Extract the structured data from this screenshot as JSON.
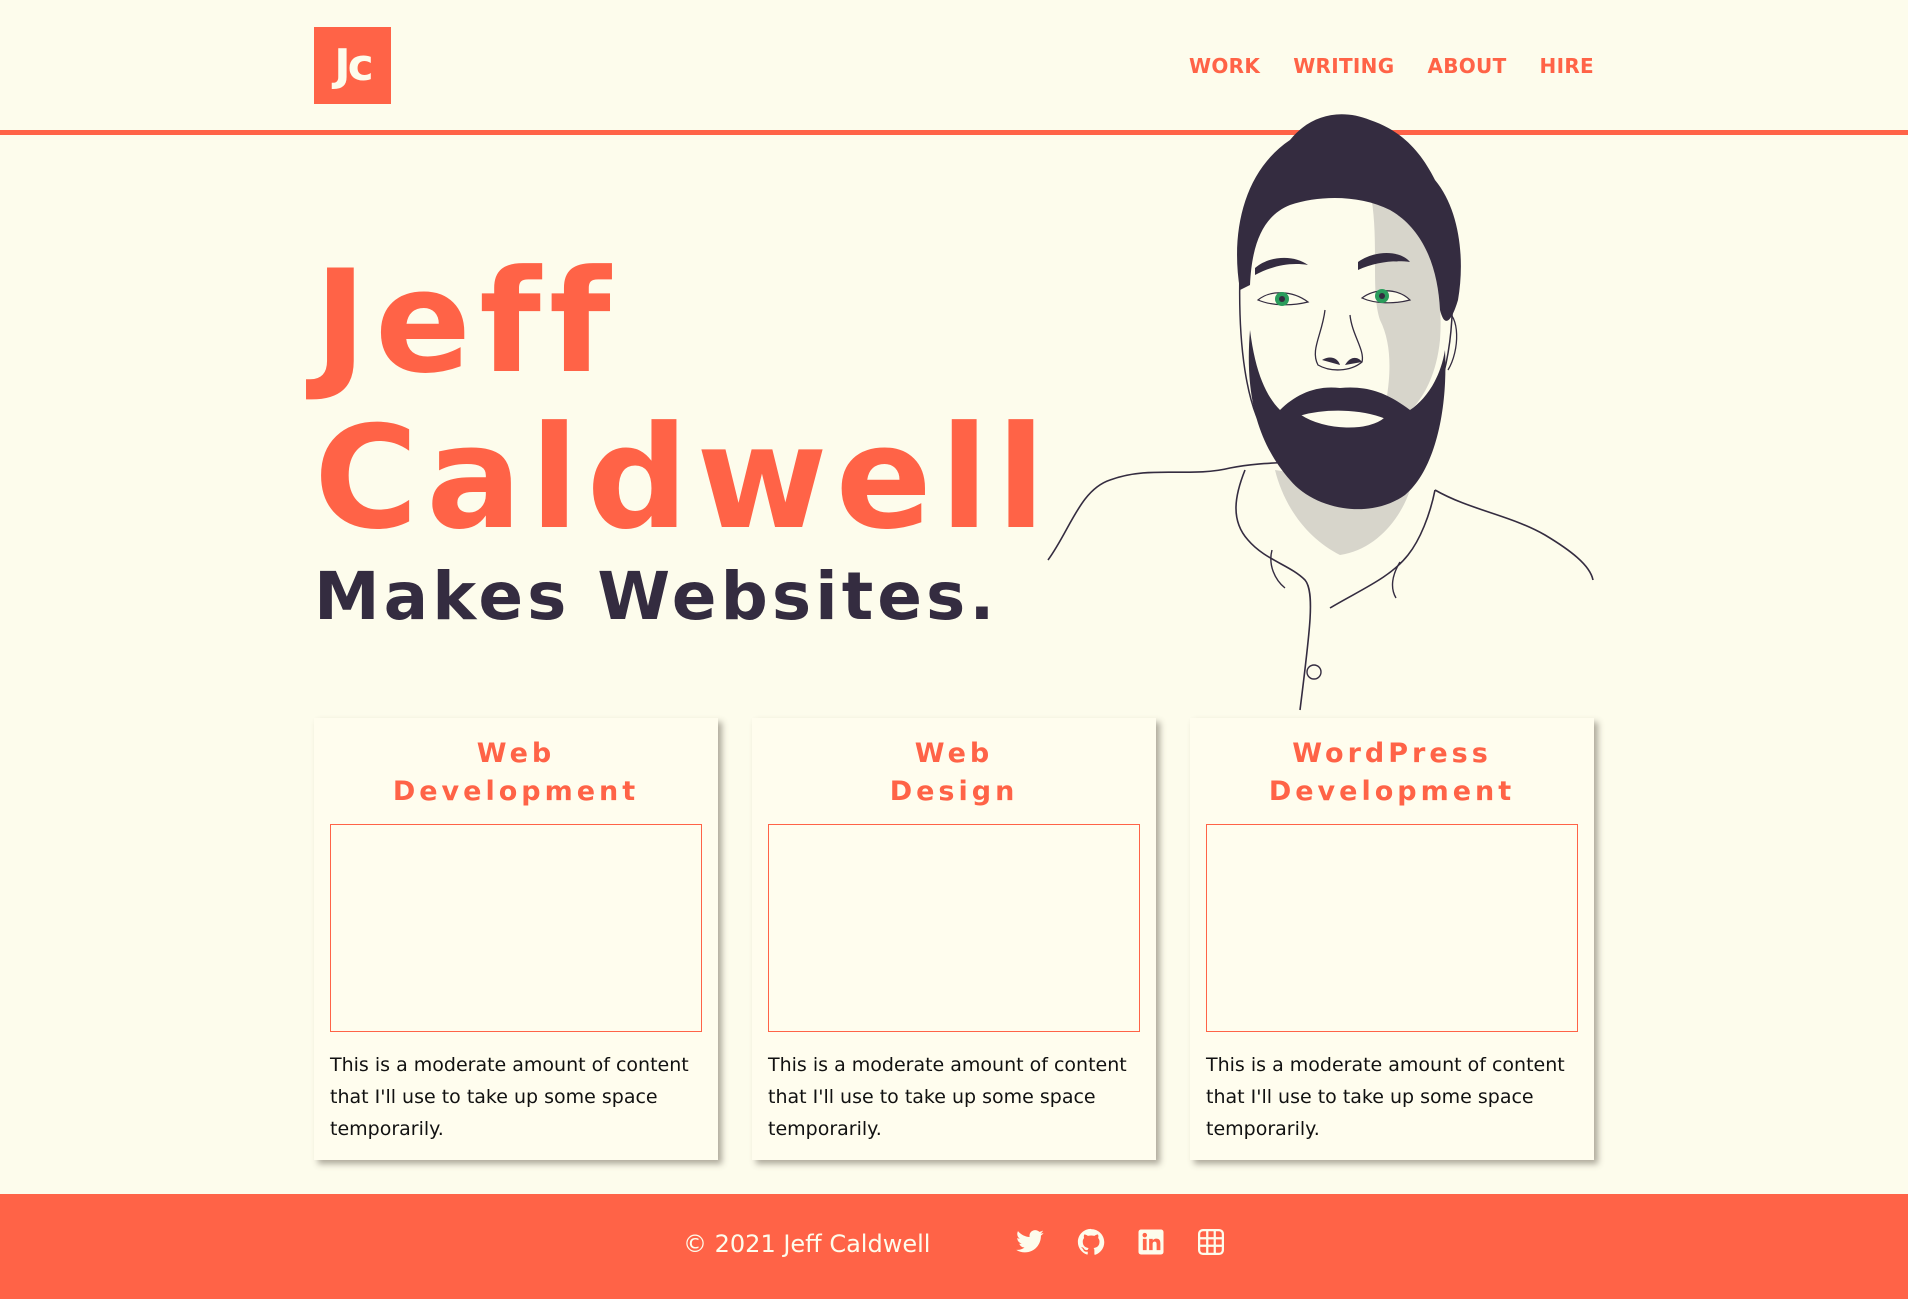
{
  "header": {
    "logo_text": "Jc",
    "nav": [
      "WORK",
      "WRITING",
      "ABOUT",
      "HIRE"
    ]
  },
  "hero": {
    "name_line1": "Jeff",
    "name_line2": "Caldwell",
    "tagline": "Makes Websites."
  },
  "cards": [
    {
      "title_line1": "Web",
      "title_line2": "Development",
      "text": "This is a moderate amount of content that I'll use to take up some space temporarily."
    },
    {
      "title_line1": "Web",
      "title_line2": "Design",
      "text": "This is a moderate amount of content that I'll use to take up some space temporarily."
    },
    {
      "title_line1": "WordPress",
      "title_line2": "Development",
      "text": "This is a moderate amount of content that I'll use to take up some space temporarily."
    }
  ],
  "footer": {
    "copyright": "© 2021 Jeff Caldwell",
    "social_icons": [
      "twitter-icon",
      "github-icon",
      "linkedin-icon",
      "codepen-icon"
    ]
  },
  "colors": {
    "background": "#fdfcec",
    "accent": "#ff6347",
    "dark": "#342c40"
  }
}
